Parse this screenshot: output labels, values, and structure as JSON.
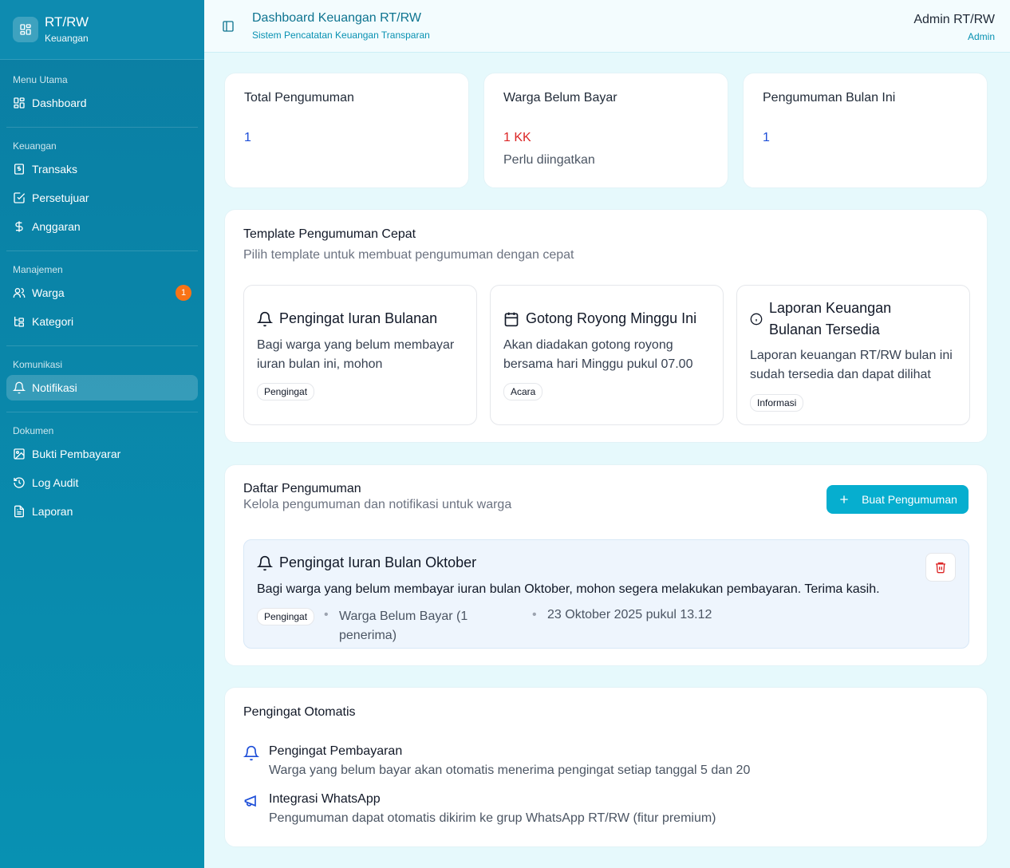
{
  "brand": {
    "title": "RT/RW",
    "subtitle": "Keuangan"
  },
  "sidebar": {
    "sections": [
      {
        "heading": "Menu Utama",
        "items": [
          {
            "label": "Dashboard",
            "icon": "dashboard-icon"
          }
        ]
      },
      {
        "heading": "Keuangan",
        "items": [
          {
            "label": "Transaks",
            "icon": "receipt-icon"
          },
          {
            "label": "Persetujuar",
            "icon": "check-square-icon"
          },
          {
            "label": "Anggaran",
            "icon": "dollar-icon"
          }
        ]
      },
      {
        "heading": "Manajemen",
        "items": [
          {
            "label": "Warga",
            "icon": "users-icon",
            "badge": "1"
          },
          {
            "label": "Kategori",
            "icon": "tree-icon"
          }
        ]
      },
      {
        "heading": "Komunikasi",
        "items": [
          {
            "label": "Notifikasi",
            "icon": "bell-icon",
            "active": true
          }
        ]
      },
      {
        "heading": "Dokumen",
        "items": [
          {
            "label": "Bukti Pembayarar",
            "icon": "image-icon"
          },
          {
            "label": "Log Audit",
            "icon": "history-icon"
          },
          {
            "label": "Laporan",
            "icon": "file-icon"
          }
        ]
      }
    ]
  },
  "header": {
    "title": "Dashboard Keuangan RT/RW",
    "subtitle": "Sistem Pencatatan Keuangan Transparan",
    "user_name": "Admin RT/RW",
    "user_role": "Admin"
  },
  "stats": [
    {
      "label": "Total Pengumuman",
      "value": "1",
      "note": ""
    },
    {
      "label": "Warga Belum Bayar",
      "value": "1 KK",
      "note": "Perlu diingatkan"
    },
    {
      "label": "Pengumuman Bulan Ini",
      "value": "1",
      "note": ""
    }
  ],
  "templates": {
    "title": "Template Pengumuman Cepat",
    "subtitle": "Pilih template untuk membuat pengumuman dengan cepat",
    "items": [
      {
        "title": "Pengingat Iuran Bulanan",
        "body": "Bagi warga yang belum membayar iuran bulan ini, mohon",
        "tag": "Pengingat",
        "icon": "bell-icon"
      },
      {
        "title": "Gotong Royong Minggu Ini",
        "body": "Akan diadakan gotong royong bersama hari Minggu pukul 07.00",
        "tag": "Acara",
        "icon": "calendar-icon"
      },
      {
        "title": "Laporan Keuangan Bulanan Tersedia",
        "body": "Laporan keuangan RT/RW bulan ini sudah tersedia dan dapat dilihat",
        "tag": "Informasi",
        "icon": "info-icon"
      }
    ]
  },
  "announcements": {
    "title": "Daftar Pengumuman",
    "subtitle": "Kelola pengumuman dan notifikasi untuk warga",
    "create_label": "Buat Pengumuman",
    "items": [
      {
        "title": "Pengingat Iuran Bulan Oktober",
        "body": "Bagi warga yang belum membayar iuran bulan Oktober, mohon segera melakukan pembayaran. Terima kasih.",
        "tag": "Pengingat",
        "recipients": "Warga Belum Bayar (1 penerima)",
        "date": "23 Oktober 2025 pukul 13.12"
      }
    ]
  },
  "auto_reminders": {
    "title": "Pengingat Otomatis",
    "items": [
      {
        "title": "Pengingat Pembayaran",
        "desc": "Warga yang belum bayar akan otomatis menerima pengingat setiap tanggal 5 dan 20",
        "icon": "bell-icon"
      },
      {
        "title": "Integrasi WhatsApp",
        "desc": "Pengumuman dapat otomatis dikirim ke grup WhatsApp RT/RW (fitur premium)",
        "icon": "megaphone-icon"
      }
    ]
  },
  "colors": {
    "accent": "#06aecf",
    "danger": "#dc2626",
    "link": "#1d4ed8",
    "sidebar": "#0b7ea3"
  }
}
